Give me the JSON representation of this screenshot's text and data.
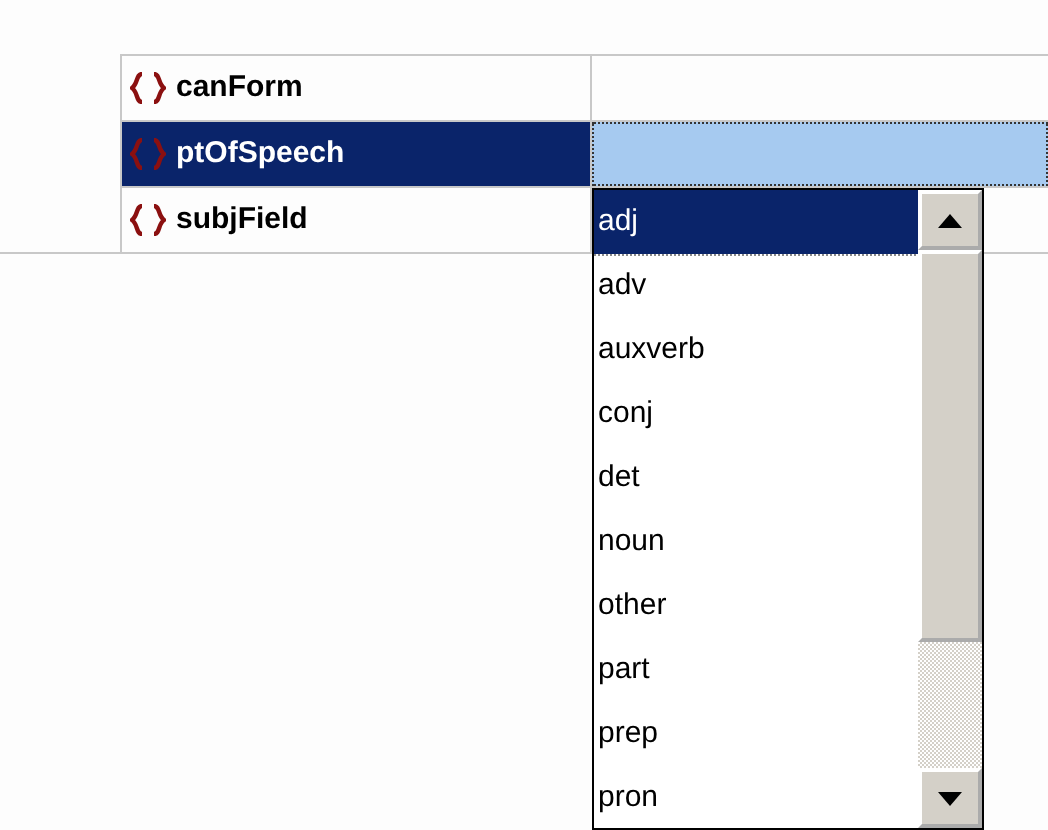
{
  "properties": [
    {
      "name": "canForm",
      "selected": false
    },
    {
      "name": "ptOfSpeech",
      "selected": true
    },
    {
      "name": "subjField",
      "selected": false
    }
  ],
  "dropdown": {
    "items": [
      {
        "label": "adj",
        "selected": true
      },
      {
        "label": "adv",
        "selected": false
      },
      {
        "label": "auxverb",
        "selected": false
      },
      {
        "label": "conj",
        "selected": false
      },
      {
        "label": "det",
        "selected": false
      },
      {
        "label": "noun",
        "selected": false
      },
      {
        "label": "other",
        "selected": false
      },
      {
        "label": "part",
        "selected": false
      },
      {
        "label": "prep",
        "selected": false
      },
      {
        "label": "pron",
        "selected": false
      }
    ]
  }
}
